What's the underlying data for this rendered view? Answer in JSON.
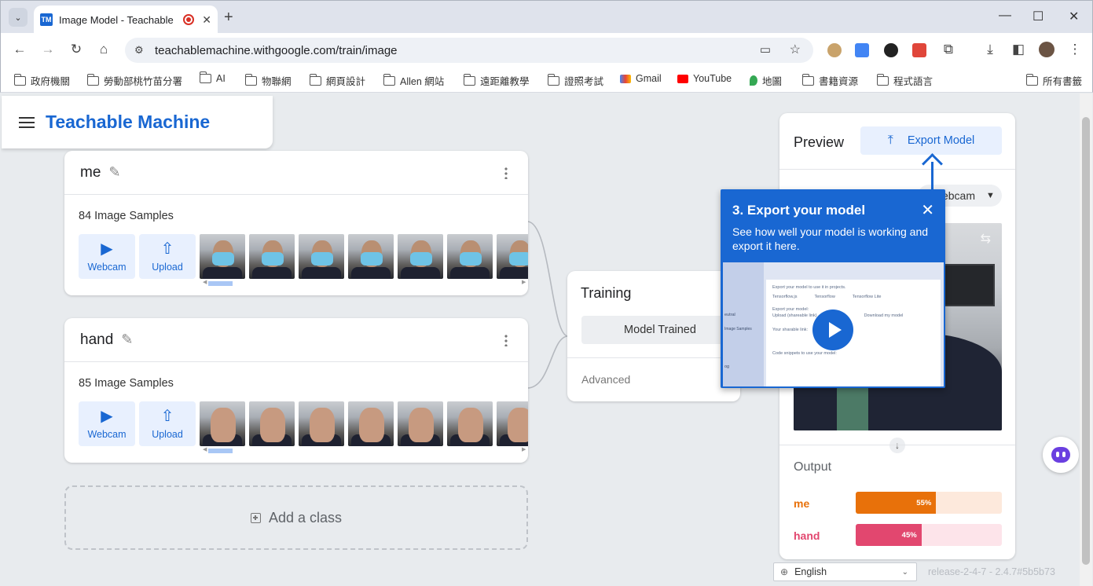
{
  "browser": {
    "tab_title": "Image Model - Teachable",
    "tab_favicon": "TM",
    "url": "teachablemachine.withgoogle.com/train/image",
    "bookmarks": [
      "政府機關",
      "勞動部桃竹苗分署",
      "AI",
      "物聯網",
      "網頁設計",
      "Allen 網站",
      "遠距離教學",
      "證照考試",
      "Gmail",
      "YouTube",
      "地圖",
      "書籍資源",
      "程式語言",
      "所有書籤"
    ]
  },
  "app": {
    "title": "Teachable Machine"
  },
  "classes": [
    {
      "name": "me",
      "samples": "84 Image Samples",
      "webcam_label": "Webcam",
      "upload_label": "Upload",
      "thumbnail_kind": "face-mask"
    },
    {
      "name": "hand",
      "samples": "85 Image Samples",
      "webcam_label": "Webcam",
      "upload_label": "Upload",
      "thumbnail_kind": "hand"
    }
  ],
  "add_class_label": "Add a class",
  "training": {
    "title": "Training",
    "button_label": "Model Trained",
    "advanced_label": "Advanced"
  },
  "preview": {
    "title": "Preview",
    "export_label": "Export Model",
    "source_select": "Webcam",
    "output_title": "Output",
    "outputs": [
      {
        "label": "me",
        "percent": 55,
        "percent_text": "55%",
        "color": "#e8710a",
        "track": "#fde9dc"
      },
      {
        "label": "hand",
        "percent": 45,
        "percent_text": "45%",
        "color": "#e2476f",
        "track": "#fde4ea"
      }
    ]
  },
  "tutorial": {
    "title": "3. Export your model",
    "description": "See how well your model is working and export it here.",
    "video_lines": [
      "Export your model to use it in projects.",
      "Tensorflow.js",
      "Tensorflow",
      "Tensorflow Lite",
      "Export your model:",
      "Upload (shareable link)",
      "Download my model",
      "Your sharable link:",
      "Code snippets to use your model:"
    ],
    "video_sidebar": [
      "eutral",
      "Image Samples",
      "og"
    ]
  },
  "footer": {
    "language": "English",
    "release": "release-2-4-7 - 2.4.7#5b5b73"
  },
  "colors": {
    "accent": "#1967d2"
  }
}
